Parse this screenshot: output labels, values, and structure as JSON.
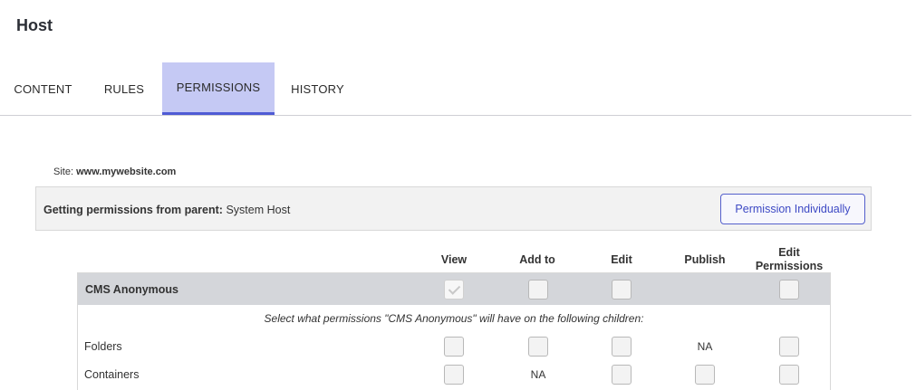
{
  "page": {
    "title": "Host"
  },
  "tabs": [
    {
      "label": "CONTENT"
    },
    {
      "label": "RULES"
    },
    {
      "label": "PERMISSIONS",
      "active": true
    },
    {
      "label": "HISTORY"
    }
  ],
  "site": {
    "label": "Site:",
    "value": "www.mywebsite.com"
  },
  "parent": {
    "label": "Getting permissions from parent:",
    "value": "System Host",
    "button_label": "Permission Individually"
  },
  "columns": [
    "View",
    "Add to",
    "Edit",
    "Publish",
    "Edit Permissions"
  ],
  "group": {
    "name": "CMS Anonymous",
    "view_checked": true
  },
  "hint": "Select what permissions \"CMS Anonymous\" will have on the following children:",
  "rows": [
    {
      "label": "Folders",
      "na_text": "NA"
    },
    {
      "label": "Containers",
      "na_text": "NA"
    }
  ],
  "colors": {
    "accent": "#4f5bd5",
    "tab_active_bg": "#c5c9f4",
    "group_bg": "#d4d6da"
  }
}
